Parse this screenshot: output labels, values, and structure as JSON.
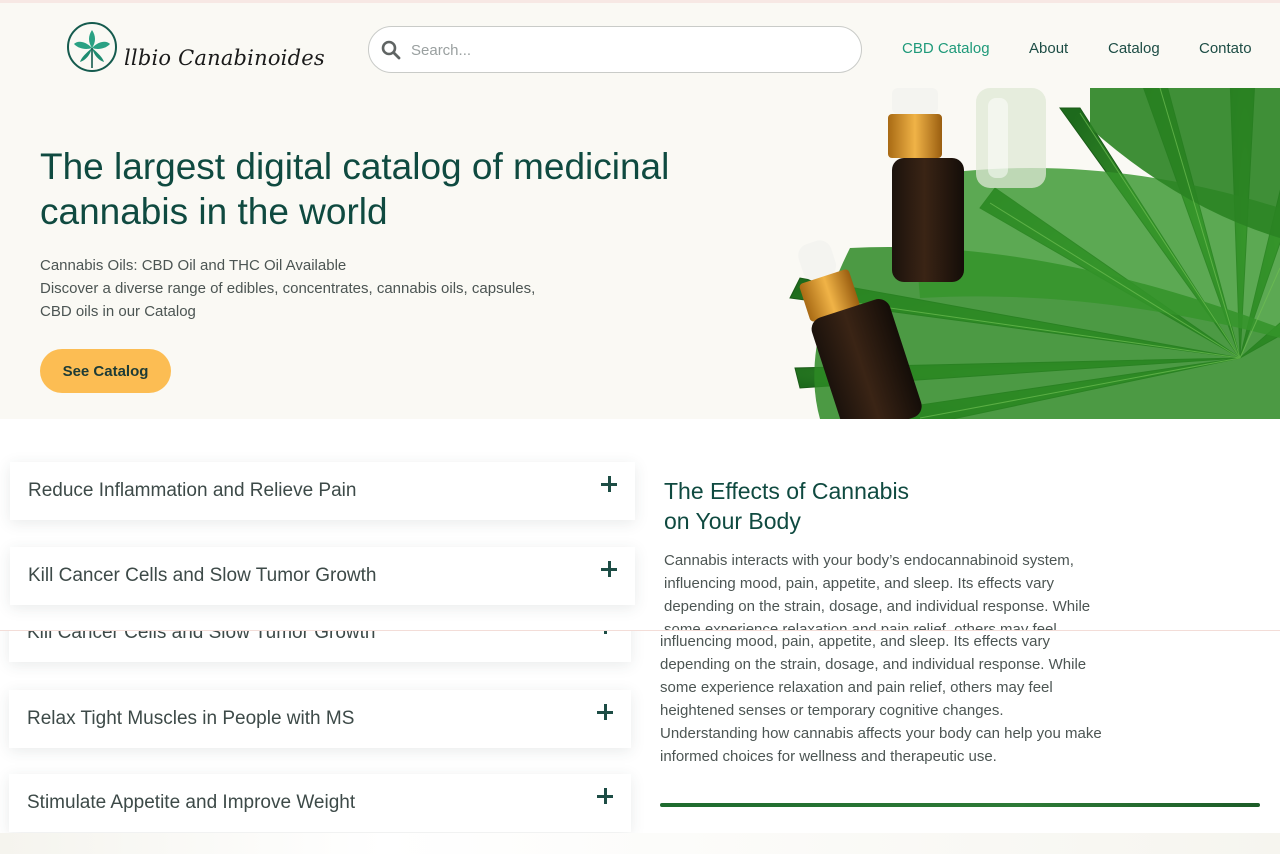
{
  "header": {
    "logo_text": "llbio Canabinoides",
    "search_placeholder": "Search...",
    "nav": [
      {
        "label": "CBD Catalog",
        "active": true
      },
      {
        "label": "About",
        "active": false
      },
      {
        "label": "Catalog",
        "active": false
      },
      {
        "label": "Contato",
        "active": false
      }
    ]
  },
  "hero": {
    "title_line1": "The largest digital catalog of medicinal",
    "title_line2": "cannabis in the world",
    "text_line1": "Cannabis Oils: CBD Oil and THC Oil Available",
    "text_line2": "Discover a diverse range of edibles, concentrates, cannabis oils, capsules,",
    "text_line3": "CBD oils in our Catalog",
    "button_label": "See Catalog"
  },
  "accordion": {
    "upper": [
      "Reduce Inflammation and Relieve Pain",
      "Kill Cancer Cells and Slow Tumor Growth"
    ],
    "lower": [
      "Kill Cancer Cells and Slow Tumor Growth",
      "Relax Tight Muscles in People with MS",
      "Stimulate Appetite and Improve Weight"
    ]
  },
  "effects": {
    "title_line1": "The Effects of Cannabis",
    "title_line2": "on Your Body",
    "upper_lines": [
      "Cannabis interacts with your body’s endocannabinoid system,",
      "influencing mood, pain, appetite, and sleep. Its effects vary",
      "depending on the strain, dosage, and individual response. While",
      "some experience relaxation and pain relief, others may feel"
    ],
    "lower_lines": [
      "influencing mood, pain, appetite, and sleep. Its effects vary",
      "depending on the strain, dosage, and individual response. While",
      "some experience relaxation and pain relief, others may feel",
      "heightened senses or temporary cognitive changes.",
      "Understanding how cannabis affects your body can help you make",
      "informed choices for wellness and therapeutic use."
    ]
  },
  "colors": {
    "primary": "#0f4a40",
    "nav_active": "#1f9a7a",
    "button": "#fcbd53",
    "hero_bg": "#faf9f4"
  }
}
